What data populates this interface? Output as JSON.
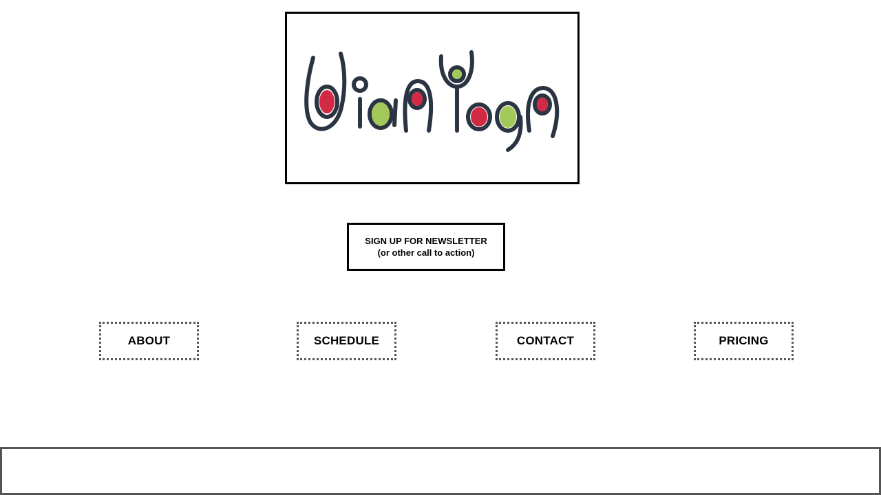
{
  "logo": {
    "name": "WidaYoga",
    "colors": {
      "stroke": "#2b3442",
      "red": "#d22a44",
      "green": "#a3c95a"
    }
  },
  "cta": {
    "line1": "SIGN UP FOR NEWSLETTER",
    "line2": "(or other call to action)"
  },
  "nav": {
    "items": [
      {
        "label": "ABOUT"
      },
      {
        "label": "SCHEDULE"
      },
      {
        "label": "CONTACT"
      },
      {
        "label": "PRICING"
      }
    ]
  },
  "colors": {
    "border": "#000000",
    "dotted_border": "#555555",
    "footer_border": "#555555"
  }
}
